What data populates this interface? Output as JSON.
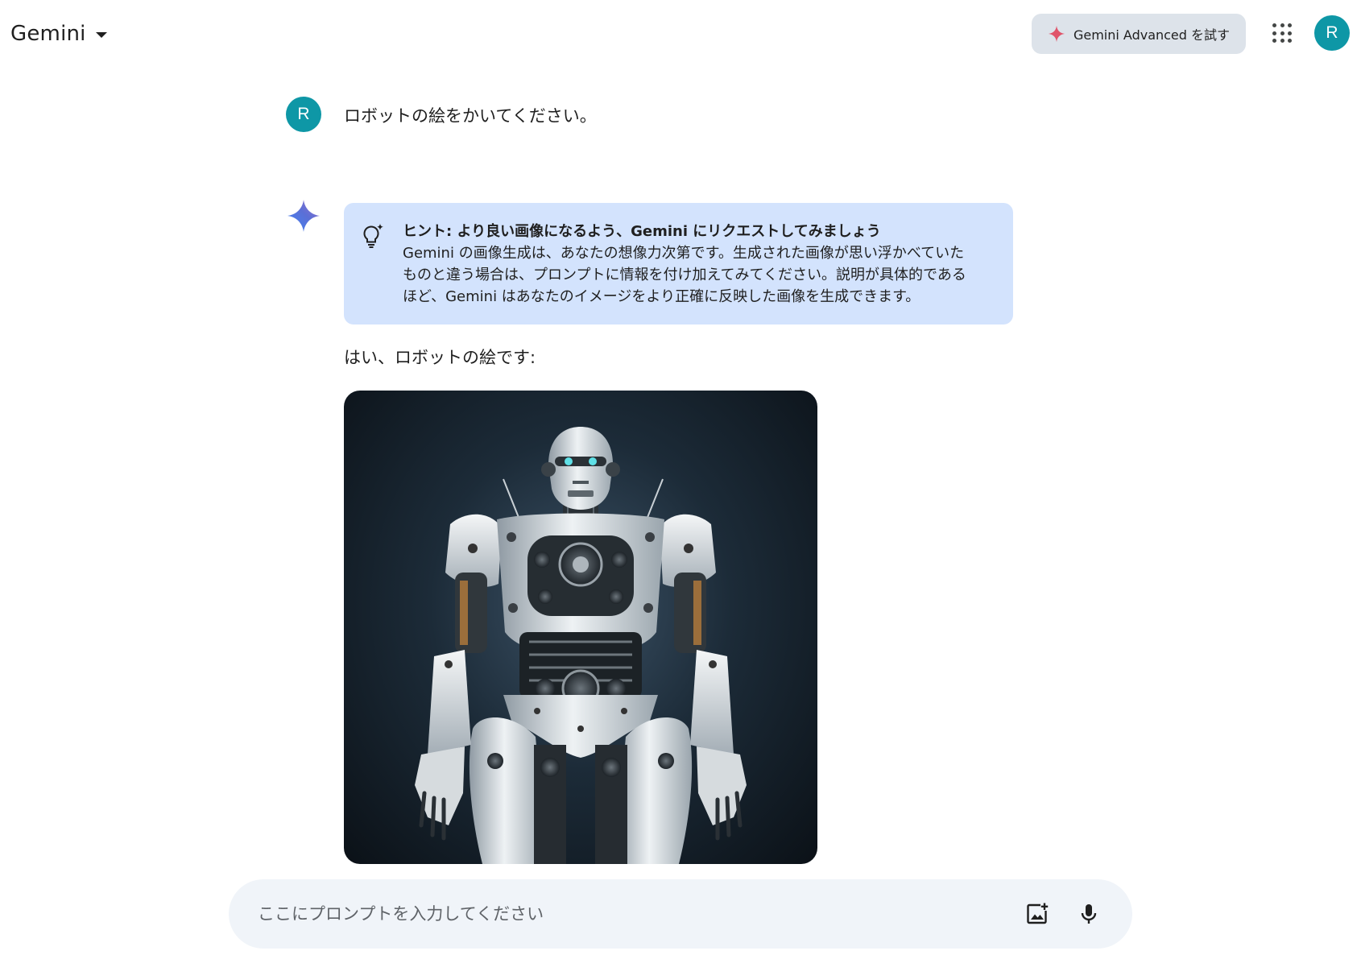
{
  "header": {
    "title": "Gemini",
    "advanced_label": "Gemini Advanced を試す",
    "avatar_letter": "R"
  },
  "conversation": {
    "user": {
      "avatar_letter": "R",
      "prompt": "ロボットの絵をかいてください。"
    },
    "response": {
      "hint": {
        "title": "ヒント: より良い画像になるよう、Gemini にリクエストしてみましょう",
        "body_lines": [
          "Gemini の画像生成は、あなたの想像力次第です。生成された画像が思い浮かべていた",
          "ものと違う場合は、プロンプトに情報を付け加えてみてください。説明が具体的である",
          "ほど、Gemini はあなたのイメージをより正確に反映した画像を生成できます。"
        ]
      },
      "text": "はい、ロボットの絵です:"
    }
  },
  "input": {
    "placeholder": "ここにプロンプトを入力してください",
    "value": ""
  },
  "icons": {
    "menu_caret": "caret-down-icon",
    "advanced": "sparkle-icon",
    "apps": "apps-grid-icon",
    "assistant": "gemini-spark-icon",
    "hint": "lightbulb-icon",
    "upload": "add-image-icon",
    "mic": "microphone-icon"
  },
  "colors": {
    "avatar": "#0e97a6",
    "hint_background": "#d3e3fd",
    "input_background": "#f0f4f9",
    "advanced_button": "#dde3ea",
    "advanced_sparkle": "#e0546a"
  }
}
